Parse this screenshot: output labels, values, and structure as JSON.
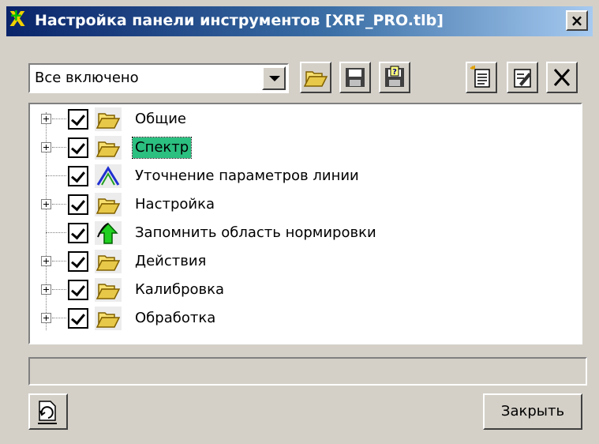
{
  "window": {
    "title": "Настройка панели инструментов [XRF_PRO.tlb]",
    "close_label": "×",
    "titlebar_color": "#0a246a"
  },
  "toolbar": {
    "preset_value": "Все включено",
    "buttons": [
      "open-folder-icon",
      "save-icon",
      "save-as-icon",
      "new-item-icon",
      "edit-item-icon",
      "delete-icon"
    ]
  },
  "tree": {
    "items": [
      {
        "label": "Общие",
        "expandable": true,
        "checked": true,
        "icon": "folder-open-icon"
      },
      {
        "label": "Спектр",
        "expandable": true,
        "checked": true,
        "icon": "folder-open-icon",
        "selected": true
      },
      {
        "label": "Уточнение параметров линии",
        "expandable": false,
        "checked": true,
        "icon": "peak-line-icon"
      },
      {
        "label": "Настройка",
        "expandable": true,
        "checked": true,
        "icon": "folder-open-icon"
      },
      {
        "label": "Запомнить область нормировки",
        "expandable": false,
        "checked": true,
        "icon": "up-arrow-icon"
      },
      {
        "label": "Действия",
        "expandable": true,
        "checked": true,
        "icon": "folder-open-icon"
      },
      {
        "label": "Калибровка",
        "expandable": true,
        "checked": true,
        "icon": "folder-open-icon"
      },
      {
        "label": "Обработка",
        "expandable": true,
        "checked": true,
        "icon": "folder-open-icon"
      }
    ],
    "selection_color": "#2bbf80"
  },
  "footer": {
    "status_text": "",
    "close_button": "Закрыть",
    "reset_icon": "reset-icon"
  }
}
